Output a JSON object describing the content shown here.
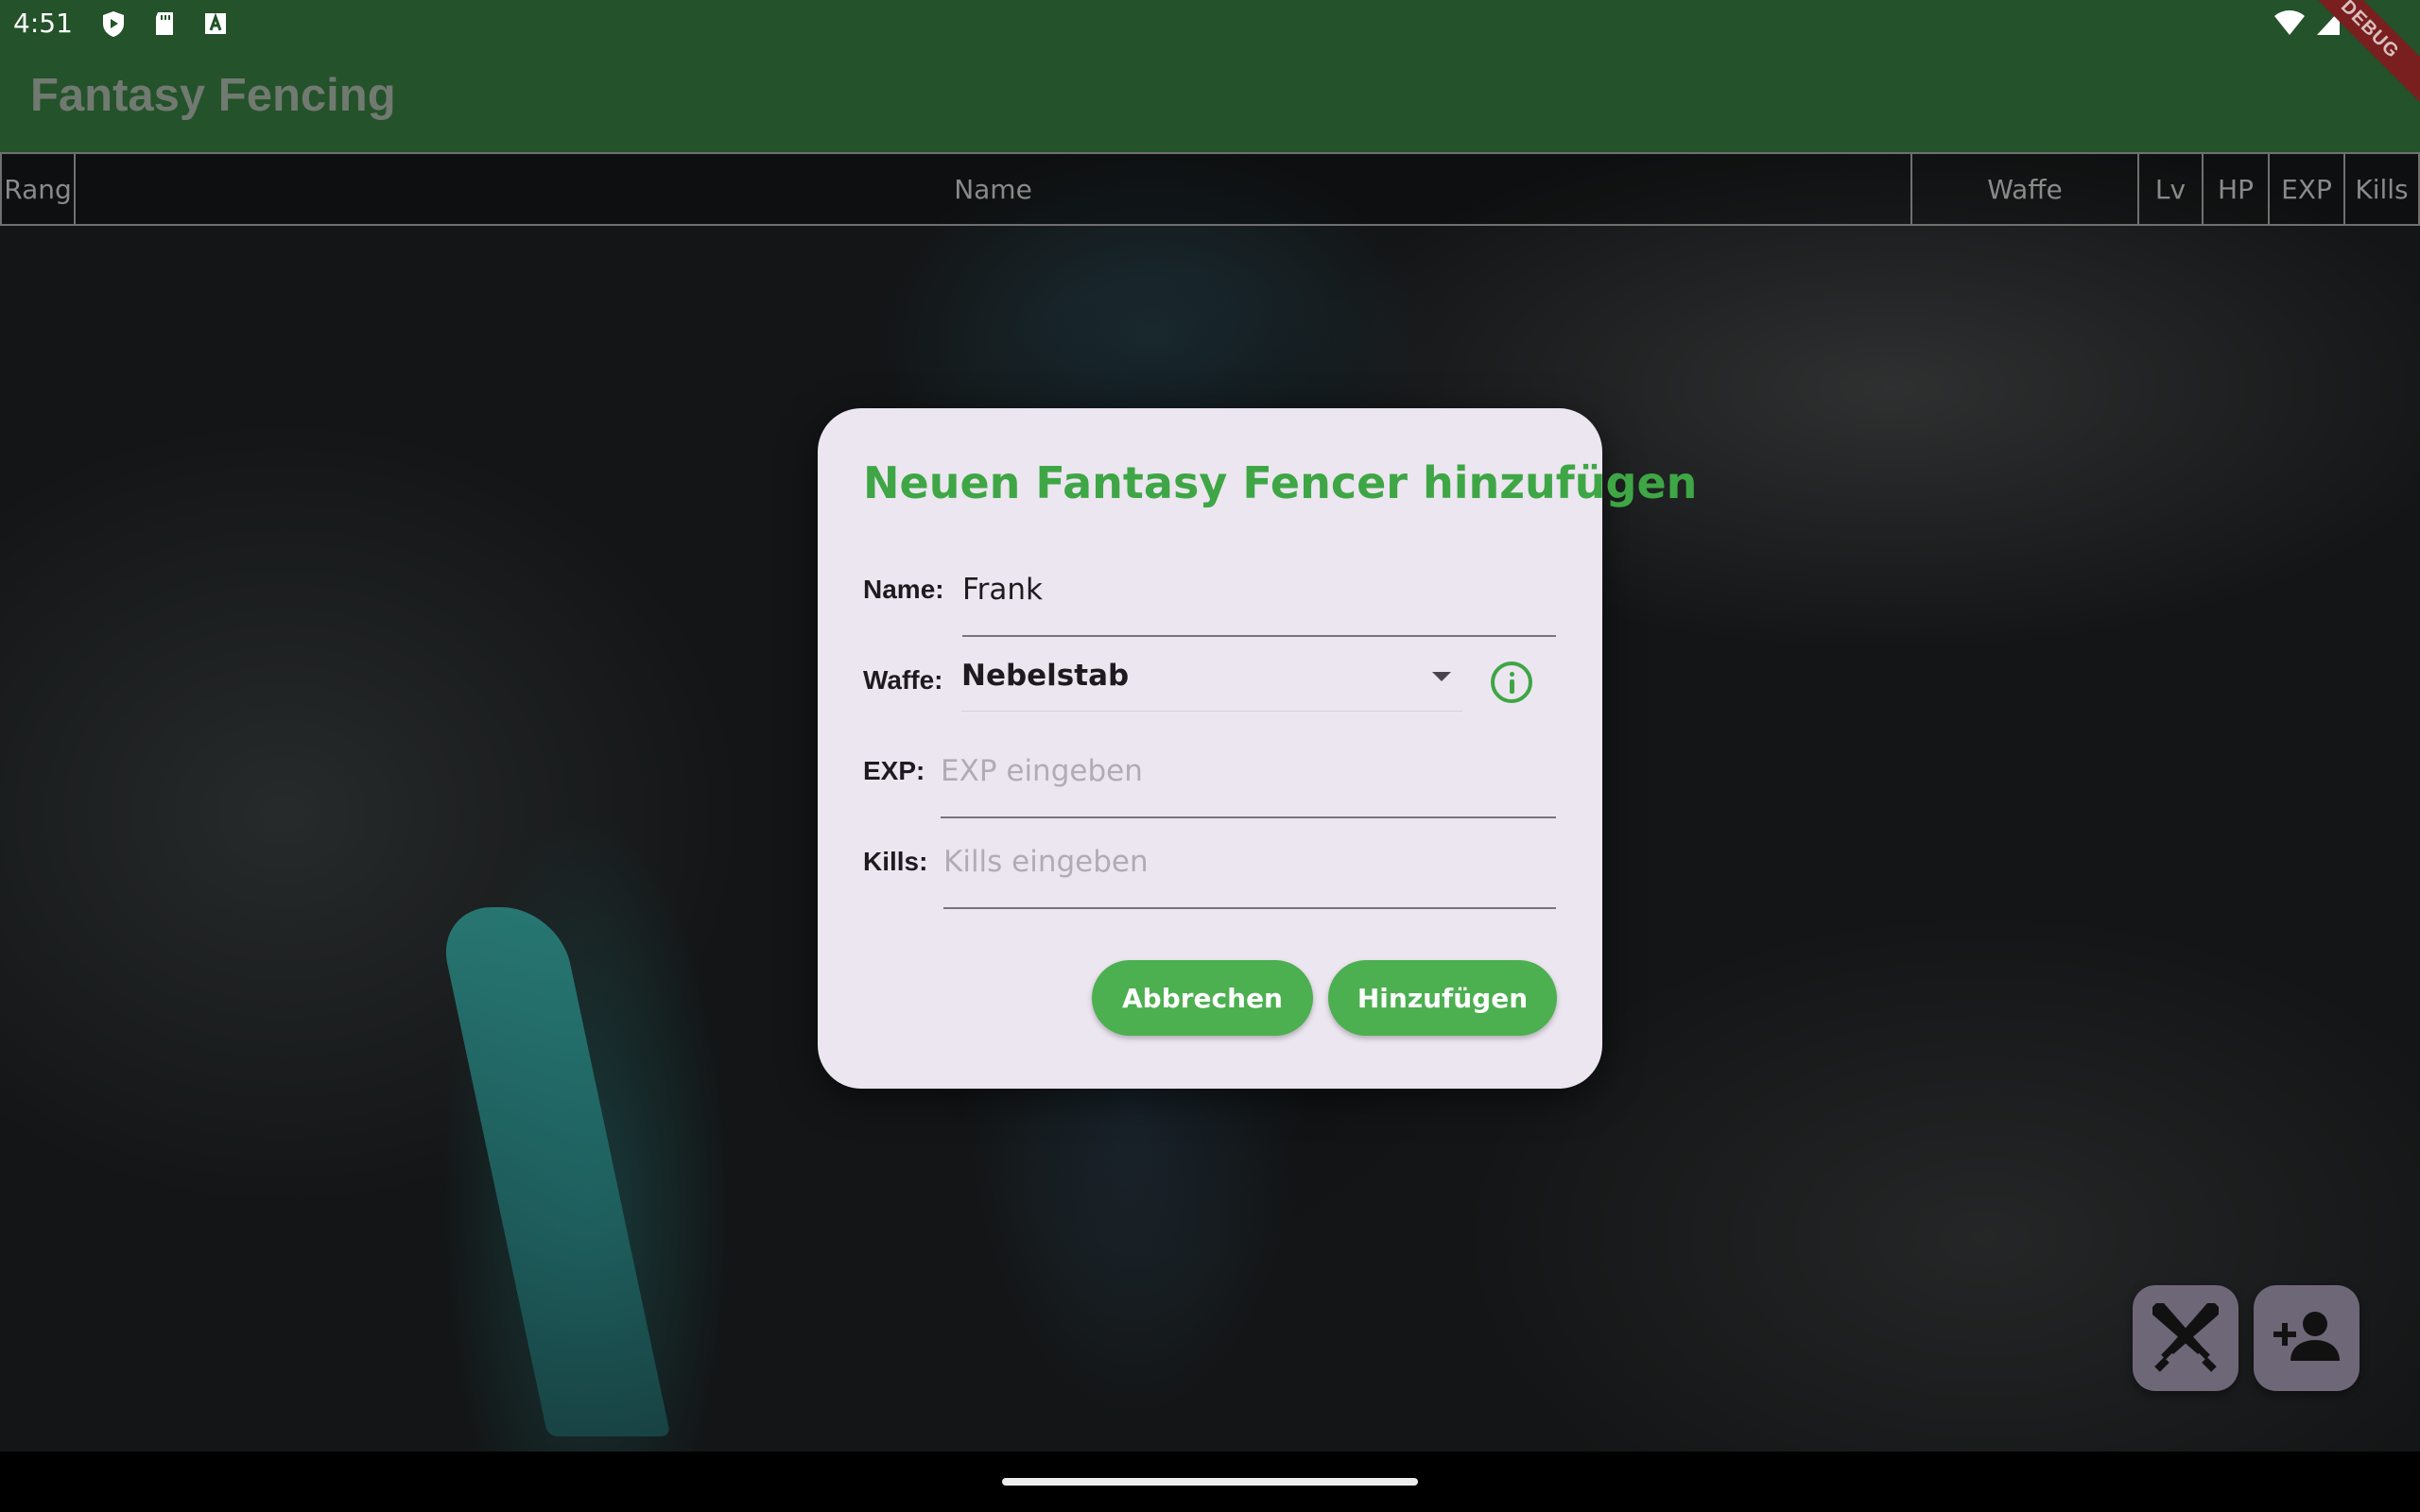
{
  "status_bar": {
    "time": "4:51",
    "left_icons": [
      "play-protect-icon",
      "sd-card-icon",
      "accessibility-a-icon"
    ],
    "right_icons": [
      "wifi-icon",
      "signal-icon",
      "battery-icon"
    ]
  },
  "app_bar": {
    "title": "Fantasy Fencing",
    "debug_banner": "DEBUG"
  },
  "table": {
    "columns": [
      "Rang",
      "Name",
      "Waffe",
      "Lv",
      "HP",
      "EXP",
      "Kills"
    ]
  },
  "dialog": {
    "title": "Neuen Fantasy Fencer hinzufügen",
    "name_label": "Name:",
    "name_value": "Frank",
    "waffe_label": "Waffe:",
    "waffe_value": "Nebelstab",
    "exp_label": "EXP:",
    "exp_placeholder": "EXP eingeben",
    "kills_label": "Kills:",
    "kills_placeholder": "Kills eingeben",
    "cancel_label": "Abbrechen",
    "add_label": "Hinzufügen"
  },
  "fabs": [
    {
      "icon": "crossed-swords-icon"
    },
    {
      "icon": "add-person-icon"
    }
  ],
  "colors": {
    "app_bar": "#24522a",
    "accent_green": "#4caf50",
    "title_green": "#3ea645",
    "dialog_bg": "#ece6f0",
    "fab_bg": "#6e6778"
  }
}
